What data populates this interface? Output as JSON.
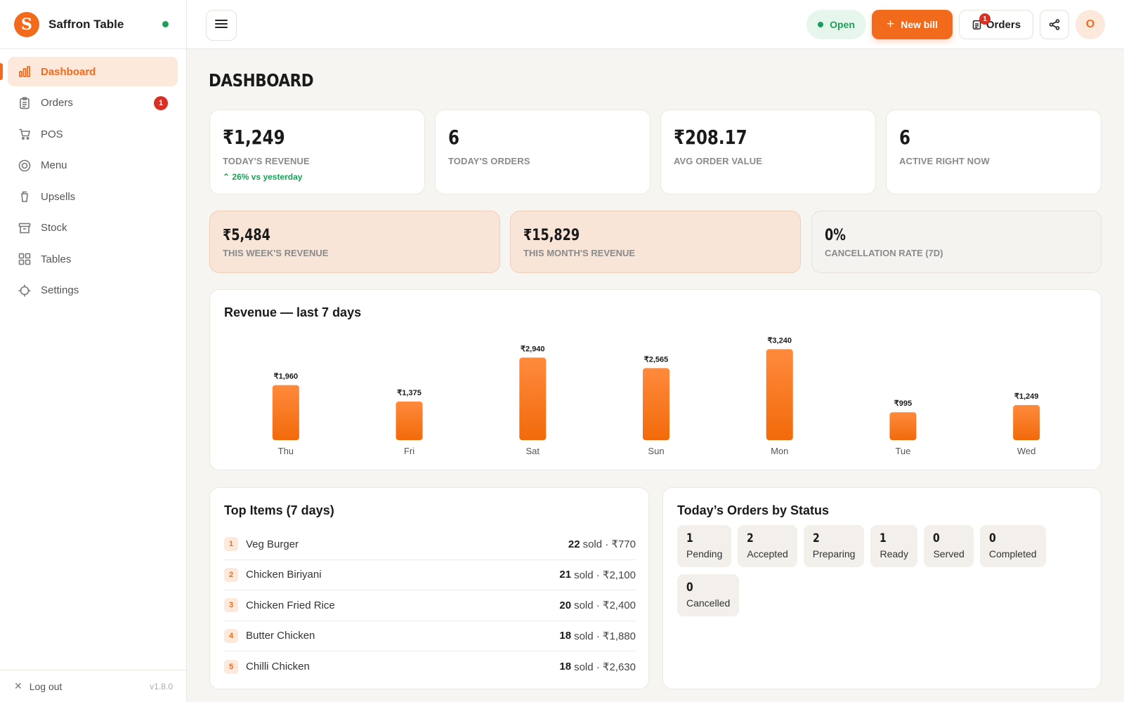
{
  "brand": {
    "initial": "S",
    "name": "Saffron Table"
  },
  "nav": [
    {
      "label": "Dashboard",
      "icon": "bar-chart-icon",
      "active": true
    },
    {
      "label": "Orders",
      "icon": "clipboard-icon",
      "badge": "1"
    },
    {
      "label": "POS",
      "icon": "cart-icon"
    },
    {
      "label": "Menu",
      "icon": "dish-icon"
    },
    {
      "label": "Upsells",
      "icon": "cup-icon"
    },
    {
      "label": "Stock",
      "icon": "archive-box-icon"
    },
    {
      "label": "Tables",
      "icon": "grid-icon"
    },
    {
      "label": "Settings",
      "icon": "crosshair-icon"
    }
  ],
  "footer": {
    "logout": "Log out",
    "version": "v1.8.0"
  },
  "topbar": {
    "status": "Open",
    "new_bill": "New bill",
    "orders": "Orders",
    "orders_badge": "1",
    "avatar": "O"
  },
  "page_title": "DASHBOARD",
  "stats": [
    {
      "value": "₹1,249",
      "label": "TODAY'S REVENUE",
      "delta": "26% vs yesterday"
    },
    {
      "value": "6",
      "label": "TODAY'S ORDERS"
    },
    {
      "value": "₹208.17",
      "label": "AVG ORDER VALUE"
    },
    {
      "value": "6",
      "label": "ACTIVE RIGHT NOW"
    }
  ],
  "secondary": [
    {
      "value": "₹5,484",
      "label": "THIS WEEK'S REVENUE"
    },
    {
      "value": "₹15,829",
      "label": "THIS MONTH'S REVENUE"
    },
    {
      "value": "0%",
      "label": "CANCELLATION RATE (7D)"
    }
  ],
  "chart_title": "Revenue — last 7 days",
  "chart_data": {
    "type": "bar",
    "title": "Revenue — last 7 days",
    "categories": [
      "Thu",
      "Fri",
      "Sat",
      "Sun",
      "Mon",
      "Tue",
      "Wed"
    ],
    "values": [
      1960,
      1375,
      2940,
      2565,
      3240,
      995,
      1249
    ],
    "labels": [
      "₹1,960",
      "₹1,375",
      "₹2,940",
      "₹2,565",
      "₹3,240",
      "₹995",
      "₹1,249"
    ],
    "color": "#f97316",
    "ylim": [
      0,
      3300
    ],
    "grid": false
  },
  "top_items": {
    "title": "Top Items (7 days)",
    "rows": [
      {
        "rank": "1",
        "name": "Veg Burger",
        "sold": "22",
        "rest": "sold · ₹770"
      },
      {
        "rank": "2",
        "name": "Chicken Biriyani",
        "sold": "21",
        "rest": "sold · ₹2,100"
      },
      {
        "rank": "3",
        "name": "Chicken Fried Rice",
        "sold": "20",
        "rest": "sold · ₹2,400"
      },
      {
        "rank": "4",
        "name": "Butter Chicken",
        "sold": "18",
        "rest": "sold · ₹1,880"
      },
      {
        "rank": "5",
        "name": "Chilli Chicken",
        "sold": "18",
        "rest": "sold · ₹2,630"
      }
    ]
  },
  "order_status": {
    "title": "Today’s Orders by Status",
    "items": [
      {
        "count": "1",
        "label": "Pending"
      },
      {
        "count": "2",
        "label": "Accepted"
      },
      {
        "count": "2",
        "label": "Preparing"
      },
      {
        "count": "1",
        "label": "Ready"
      },
      {
        "count": "0",
        "label": "Served"
      },
      {
        "count": "0",
        "label": "Completed"
      },
      {
        "count": "0",
        "label": "Cancelled"
      }
    ]
  },
  "colors": {
    "accent": "#f26a1b",
    "success": "#18a058",
    "danger": "#d93025"
  }
}
